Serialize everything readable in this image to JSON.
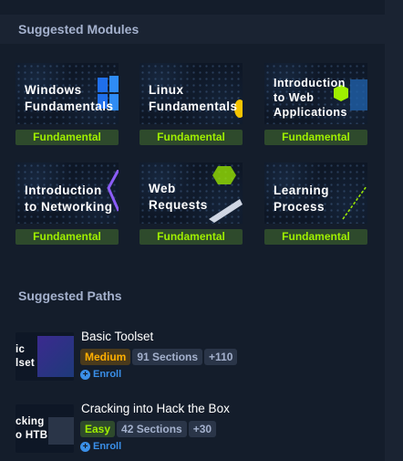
{
  "suggested_modules": {
    "heading": "Suggested Modules",
    "items": [
      {
        "title": "Windows\nFundamentals",
        "badge": "Fundamental"
      },
      {
        "title": "Linux\nFundamentals",
        "badge": "Fundamental"
      },
      {
        "title": "Introduction\nto Web\nApplications",
        "badge": "Fundamental"
      },
      {
        "title": "Introduction\nto Networking",
        "badge": "Fundamental"
      },
      {
        "title": "Web\nRequests",
        "badge": "Fundamental"
      },
      {
        "title": "Learning\nProcess",
        "badge": "Fundamental"
      }
    ]
  },
  "suggested_paths": {
    "heading": "Suggested Paths",
    "items": [
      {
        "thumb_text": "ic\nlset",
        "title": "Basic Toolset",
        "level": "Medium",
        "sections": "91 Sections",
        "extra": "+110",
        "enroll": "Enroll"
      },
      {
        "thumb_text": "cking\no HTB",
        "title": "Cracking into Hack the Box",
        "level": "Easy",
        "sections": "42 Sections",
        "extra": "+30",
        "enroll": "Enroll"
      }
    ]
  },
  "colors": {
    "background": "#141d2b",
    "panel": "#1a2332",
    "fundamental_green": "#9fef00",
    "medium_orange": "#ffaf00",
    "link_blue": "#3a8fe8"
  }
}
